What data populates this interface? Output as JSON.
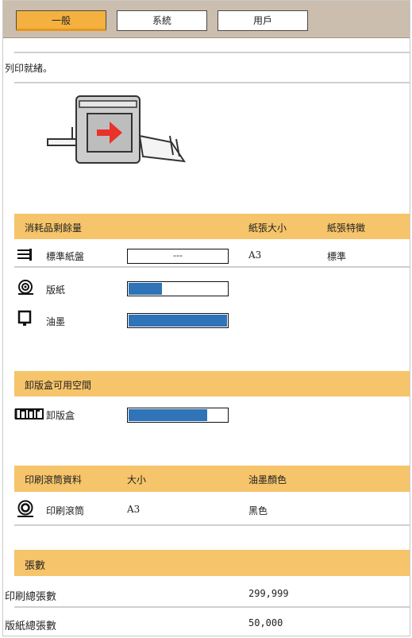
{
  "tabs": [
    {
      "label": "一般",
      "active": true
    },
    {
      "label": "系統",
      "active": false
    },
    {
      "label": "用戶",
      "active": false
    }
  ],
  "status_message": "列印就緒。",
  "consumables": {
    "headers": {
      "remaining": "消耗品剩餘量",
      "paper_size": "紙張大小",
      "paper_feature": "紙張特徵"
    },
    "rows": [
      {
        "label": "標準紙盤",
        "level_text": "---",
        "paper_size": "A3",
        "paper_feature": "標準",
        "icon": "paper-tray-icon"
      },
      {
        "label": "版紙",
        "level_percent": 35,
        "icon": "master-roll-icon"
      },
      {
        "label": "油墨",
        "level_percent": 100,
        "icon": "ink-cartridge-icon"
      }
    ]
  },
  "disposal": {
    "header": "卸版盒可用空間",
    "row": {
      "label": "卸版盒",
      "level_percent": 80,
      "icon": "disposal-box-icon"
    }
  },
  "drum": {
    "headers": {
      "info": "印刷滾筒資料",
      "size": "大小",
      "ink_color": "油墨顏色"
    },
    "row": {
      "label": "印刷滾筒",
      "size": "A3",
      "ink_color": "黑色",
      "icon": "print-drum-icon"
    }
  },
  "counts": {
    "header": "張數",
    "rows": [
      {
        "label": "印刷總張數",
        "value": "299,999"
      },
      {
        "label": "版紙總張數",
        "value": "50,000"
      }
    ]
  },
  "colors": {
    "accent": "#f6c46a",
    "active_tab": "#f5b13f",
    "tabbar": "#cbbeae",
    "bar_fill": "#2f73b8",
    "arrow": "#e8322a"
  }
}
